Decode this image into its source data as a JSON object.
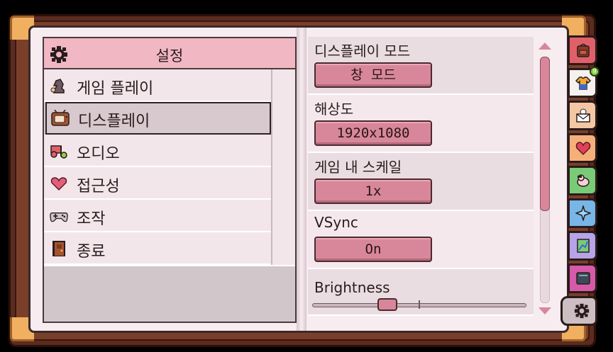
{
  "menu": {
    "title": "설정",
    "items": [
      {
        "label": "게임 플레이",
        "icon": "chess-knight-icon"
      },
      {
        "label": "디스플레이",
        "icon": "tv-icon"
      },
      {
        "label": "오디오",
        "icon": "music-note-icon"
      },
      {
        "label": "접근성",
        "icon": "heart-icon"
      },
      {
        "label": "조작",
        "icon": "gamepad-icon"
      },
      {
        "label": "종료",
        "icon": "door-icon"
      }
    ],
    "selected": "디스플레이"
  },
  "settings": {
    "display_mode": {
      "label": "디스플레이 모드",
      "value": "창 모드"
    },
    "resolution": {
      "label": "해상도",
      "value": "1920x1080"
    },
    "ingame_scale": {
      "label": "게임 내 스케일",
      "value": "1x"
    },
    "vsync": {
      "label": "VSync",
      "value": "On"
    },
    "brightness": {
      "label": "Brightness",
      "level": 0.35
    }
  },
  "tabs": [
    {
      "name": "backpack-icon",
      "color": "#e0606a"
    },
    {
      "name": "shirt-icon",
      "color": "#f4f1ee",
      "badge": "9"
    },
    {
      "name": "envelope-icon",
      "color": "#f3c7a4"
    },
    {
      "name": "heart-icon",
      "color": "#f5b07a"
    },
    {
      "name": "bird-icon",
      "color": "#7acb78"
    },
    {
      "name": "sparkle-icon",
      "color": "#78b6e8"
    },
    {
      "name": "map-icon",
      "color": "#b7a3e8"
    },
    {
      "name": "journal-icon",
      "color": "#d65aa8"
    },
    {
      "name": "gear-icon",
      "color": "#cdbec4"
    }
  ],
  "colors": {
    "accent": "#d8879a",
    "header": "#f1b7c2",
    "page": "#f7ecf0",
    "frame": "#5a2c1f"
  }
}
